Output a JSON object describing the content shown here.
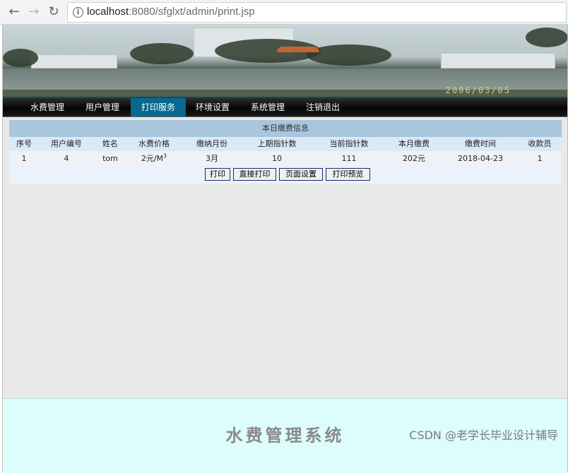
{
  "browser": {
    "back_icon": "arrow-left-icon",
    "forward_icon": "arrow-right-icon",
    "reload_icon": "reload-icon",
    "info_icon": "info-icon",
    "url_host": "localhost",
    "url_rest": ":8080/sfglxt/admin/print.jsp"
  },
  "banner": {
    "date_stamp": "2006/03/05"
  },
  "nav": {
    "items": [
      {
        "label": "水费管理"
      },
      {
        "label": "用户管理"
      },
      {
        "label": "打印服务"
      },
      {
        "label": "环境设置"
      },
      {
        "label": "系统管理"
      },
      {
        "label": "注销退出"
      }
    ],
    "active": "打印服务"
  },
  "table": {
    "title": "本日缴费信息",
    "headers": [
      "序号",
      "用户编号",
      "姓名",
      "水费价格",
      "缴纳月份",
      "上期指针数",
      "当前指针数",
      "本月缴费",
      "缴费时间",
      "收款员"
    ],
    "row": {
      "seq": "1",
      "user_id": "4",
      "name": "tom",
      "price": "2元/M",
      "price_sup": "3",
      "month": "3月",
      "last_reading": "10",
      "current_reading": "111",
      "monthly_fee": "202元",
      "pay_time": "2018-04-23",
      "cashier": "1"
    }
  },
  "buttons": {
    "print": "打印",
    "direct_print": "直接打印",
    "page_setup": "页面设置",
    "print_preview": "打印预览"
  },
  "footer": {
    "title": "水费管理系统"
  },
  "watermark": "CSDN @老学长毕业设计辅导"
}
